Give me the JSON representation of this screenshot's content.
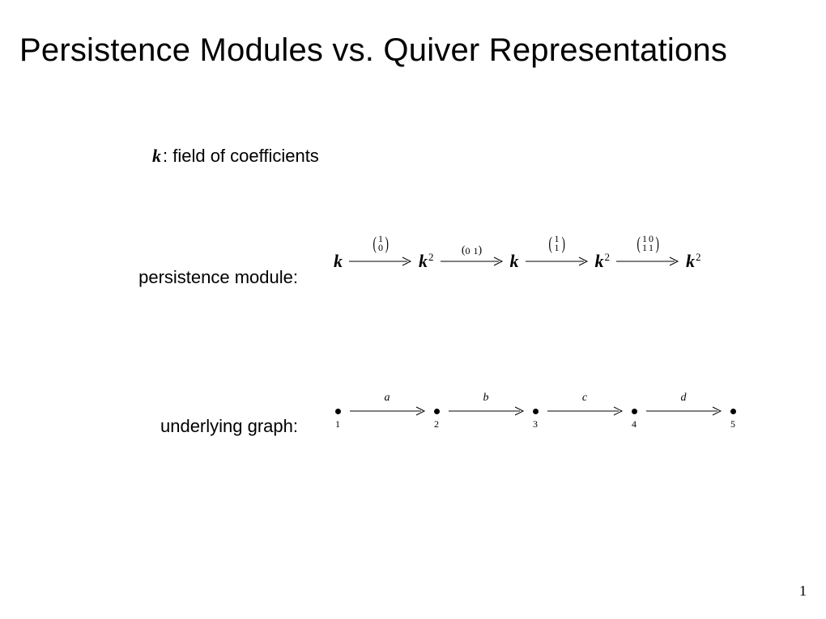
{
  "title": "Persistence Modules vs. Quiver Representations",
  "field_symbol": "k",
  "field_text": ": field of coefficients",
  "labels": {
    "persistence": "persistence module:",
    "graph": "underlying graph:"
  },
  "pm": {
    "objects": [
      "k",
      "k²",
      "k",
      "k²",
      "k²"
    ],
    "maps": [
      {
        "type": "col2",
        "rows": [
          "1",
          "0"
        ]
      },
      {
        "type": "row2",
        "cols": [
          "0",
          "1"
        ]
      },
      {
        "type": "col2",
        "rows": [
          "1",
          "1"
        ]
      },
      {
        "type": "mat22",
        "rows": [
          [
            "1",
            "0"
          ],
          [
            "1",
            "1"
          ]
        ]
      }
    ]
  },
  "graph": {
    "nodes": [
      "1",
      "2",
      "3",
      "4",
      "5"
    ],
    "edges": [
      "a",
      "b",
      "c",
      "d"
    ]
  },
  "page": "1"
}
